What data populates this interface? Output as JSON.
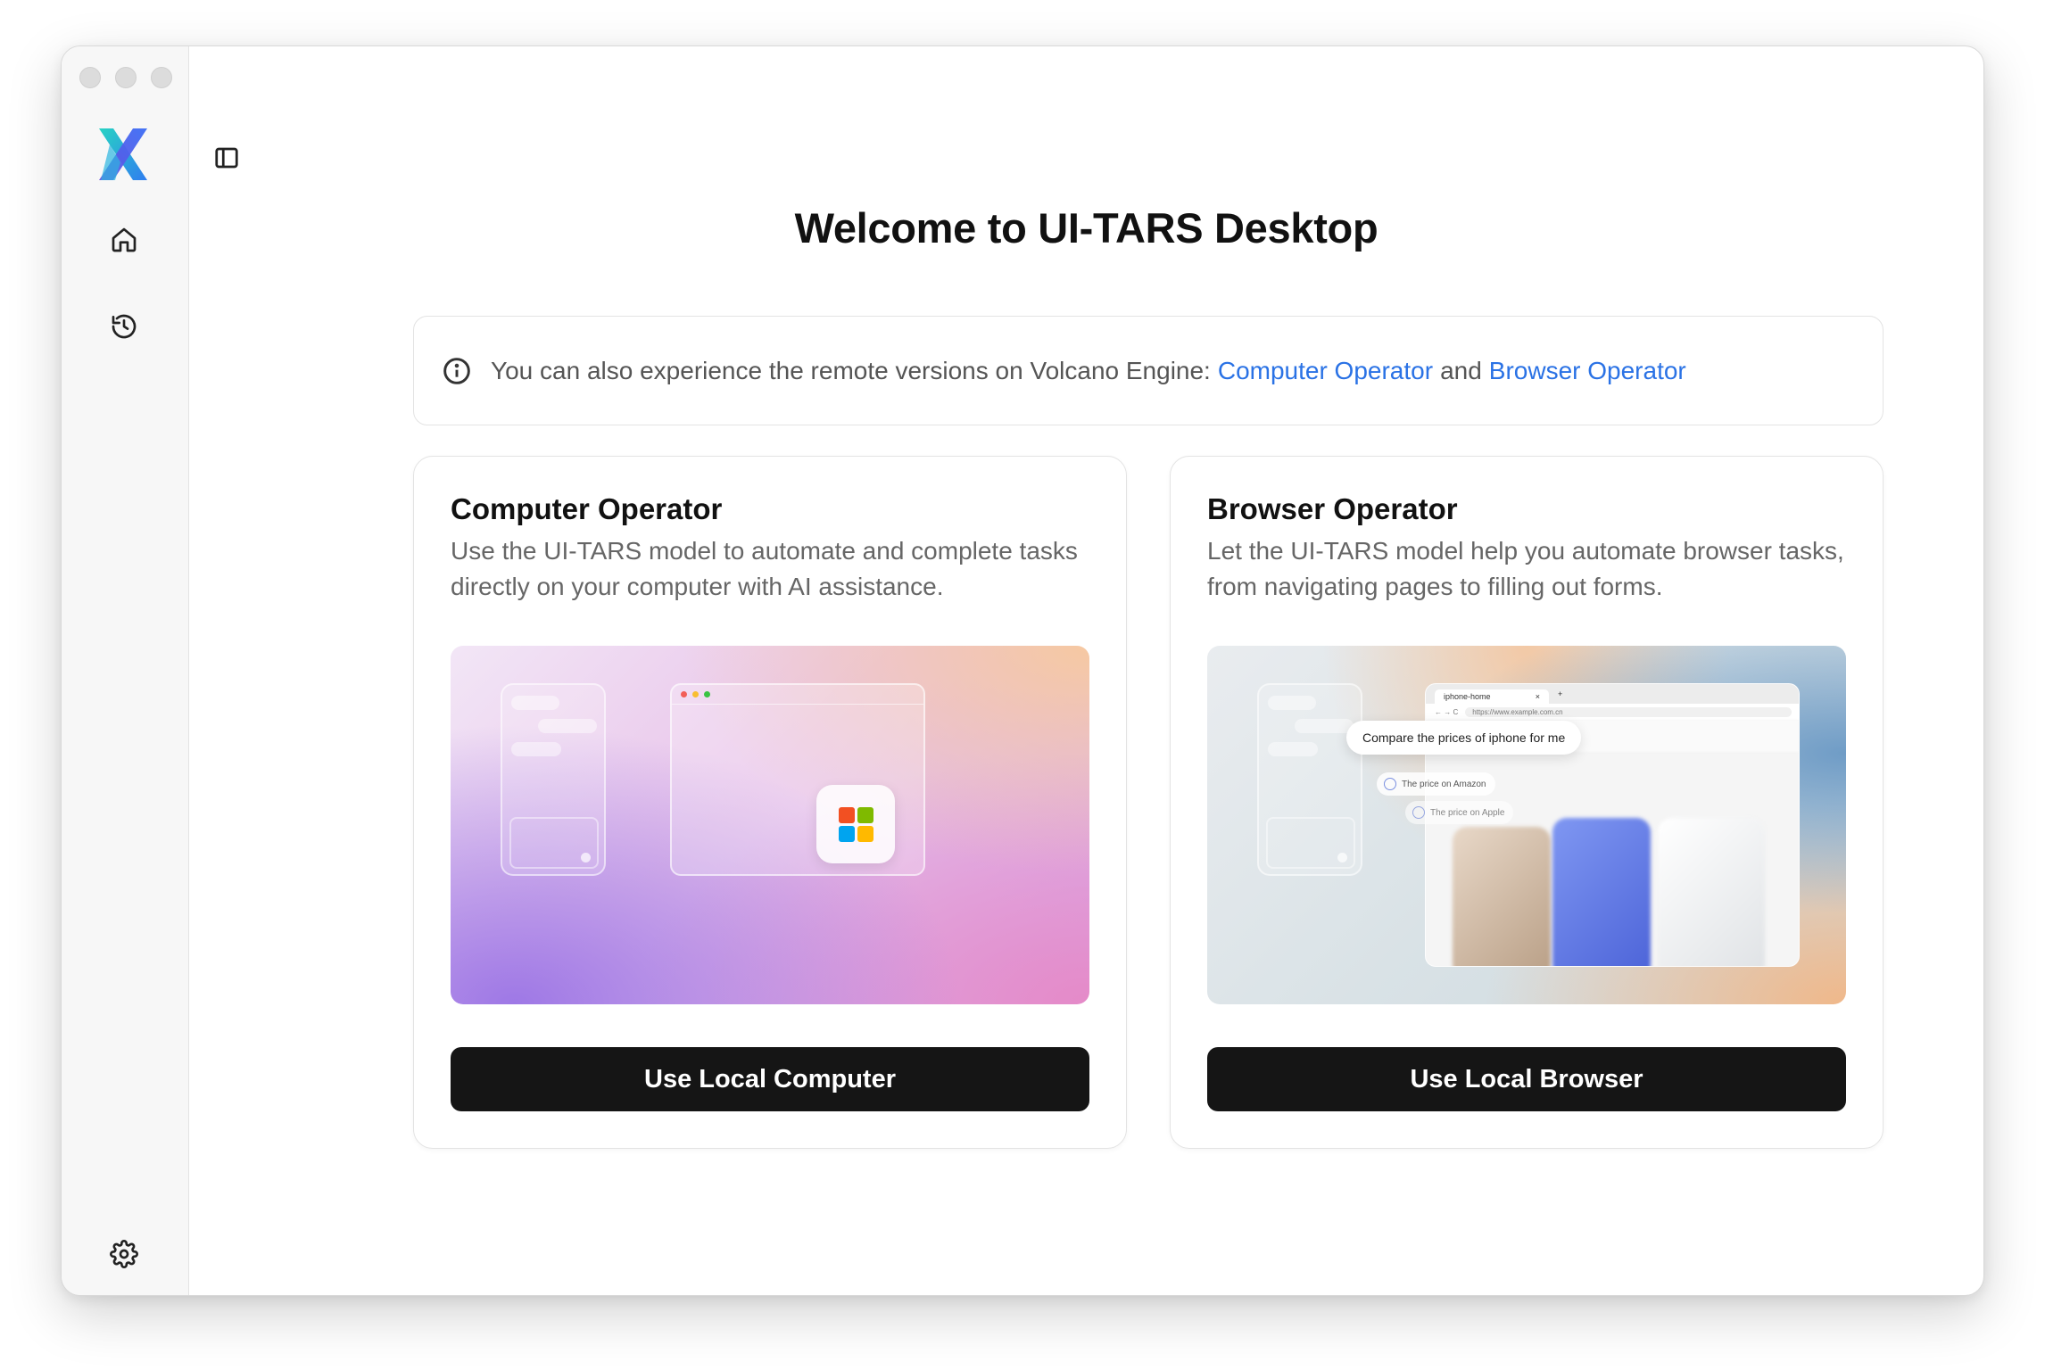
{
  "window": {
    "title": "Welcome to UI-TARS Desktop"
  },
  "sidebar": {
    "items": [
      {
        "name": "home",
        "icon": "home-icon"
      },
      {
        "name": "history",
        "icon": "history-icon"
      },
      {
        "name": "settings",
        "icon": "gear-icon"
      }
    ]
  },
  "info": {
    "text": "You can also experience the remote versions on Volcano Engine:",
    "link1": "Computer Operator",
    "sep": "and",
    "link2": "Browser Operator"
  },
  "cards": [
    {
      "title": "Computer Operator",
      "description": "Use the UI-TARS model to automate and complete tasks directly on your computer with AI assistance.",
      "button": "Use Local Computer"
    },
    {
      "title": "Browser Operator",
      "description": "Let the UI-TARS model help you automate browser tasks, from navigating pages to filling out forms.",
      "button": "Use Local Browser"
    }
  ],
  "browser_preview": {
    "tab": "iphone-home",
    "url": "https://www.example.com.cn",
    "prompt": "Compare the prices of iphone for me",
    "chip1": "The price on Amazon",
    "chip2": "The price on Apple"
  },
  "colors": {
    "link": "#2a72e5",
    "button_bg": "#151515"
  }
}
